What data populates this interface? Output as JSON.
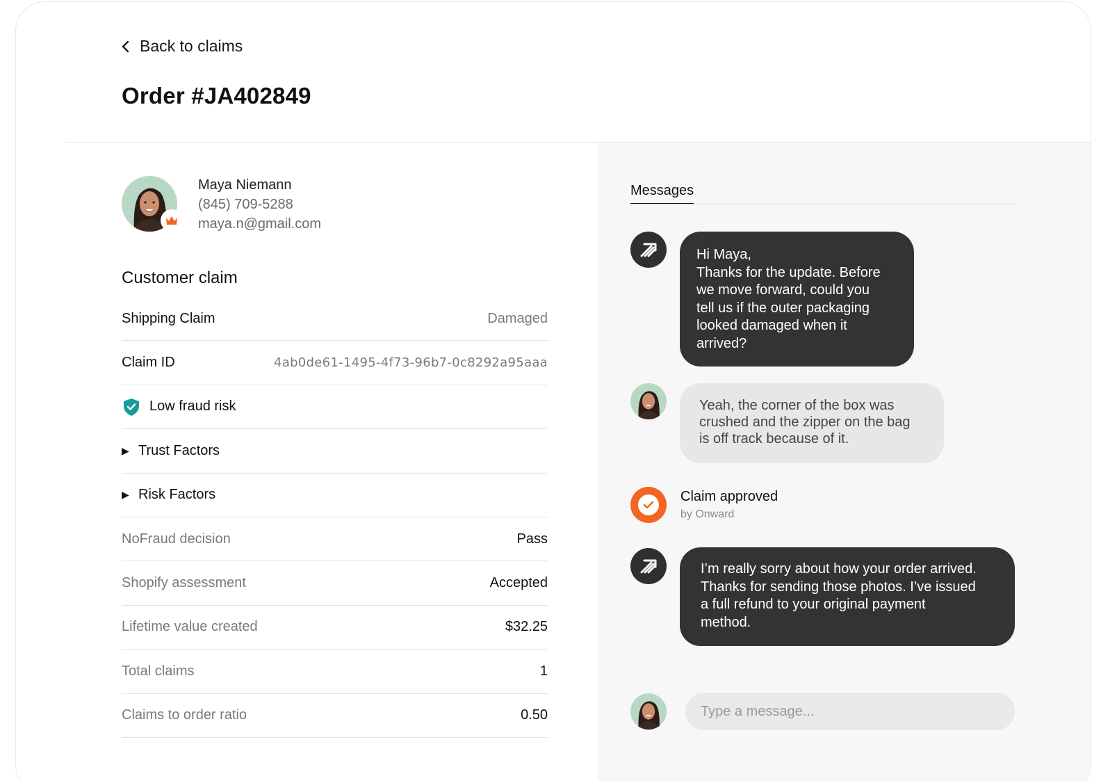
{
  "header": {
    "back_label": "Back to claims",
    "order_title": "Order #JA402849"
  },
  "customer": {
    "name": "Maya Niemann",
    "phone": "(845) 709-5288",
    "email": "maya.n@gmail.com",
    "badge_icon": "crown-icon"
  },
  "claim": {
    "section_title": "Customer claim",
    "shipping_claim_label": "Shipping Claim",
    "shipping_claim_value": "Damaged",
    "claim_id_label": "Claim ID",
    "claim_id_value": "4ab0de61-1495-4f73-96b7-0c8292a95aaa",
    "fraud_risk_label": "Low fraud risk",
    "trust_factors_label": "Trust Factors",
    "risk_factors_label": "Risk Factors",
    "metrics": [
      {
        "label": "NoFraud decision",
        "value": "Pass"
      },
      {
        "label": "Shopify assessment",
        "value": "Accepted"
      },
      {
        "label": "Lifetime value created",
        "value": "$32.25"
      },
      {
        "label": "Total claims",
        "value": "1"
      },
      {
        "label": "Claims to order ratio",
        "value": "0.50"
      }
    ]
  },
  "messages": {
    "tab_label": "Messages",
    "items": [
      {
        "sender": "agent",
        "text": "Hi Maya,\nThanks for the update. Before\nwe move forward, could you\ntell us if the outer packaging\nlooked damaged when it\narrived?"
      },
      {
        "sender": "customer",
        "text": "Yeah, the corner of the box was\ncrushed and the zipper on the bag\nis off track because of it."
      },
      {
        "sender": "agent",
        "text": "I’m really sorry about how your order arrived.\nThanks for sending those photos. I’ve issued\na full refund to your original payment\nmethod."
      }
    ],
    "event": {
      "title": "Claim approved",
      "by": "by Onward"
    },
    "input_placeholder": "Type a message..."
  },
  "colors": {
    "accent_orange": "#f26522",
    "shield_teal": "#1a9a9a",
    "bubble_dark": "#333333",
    "bubble_light": "#e7e7e7",
    "panel_bg": "#f7f7f7"
  }
}
